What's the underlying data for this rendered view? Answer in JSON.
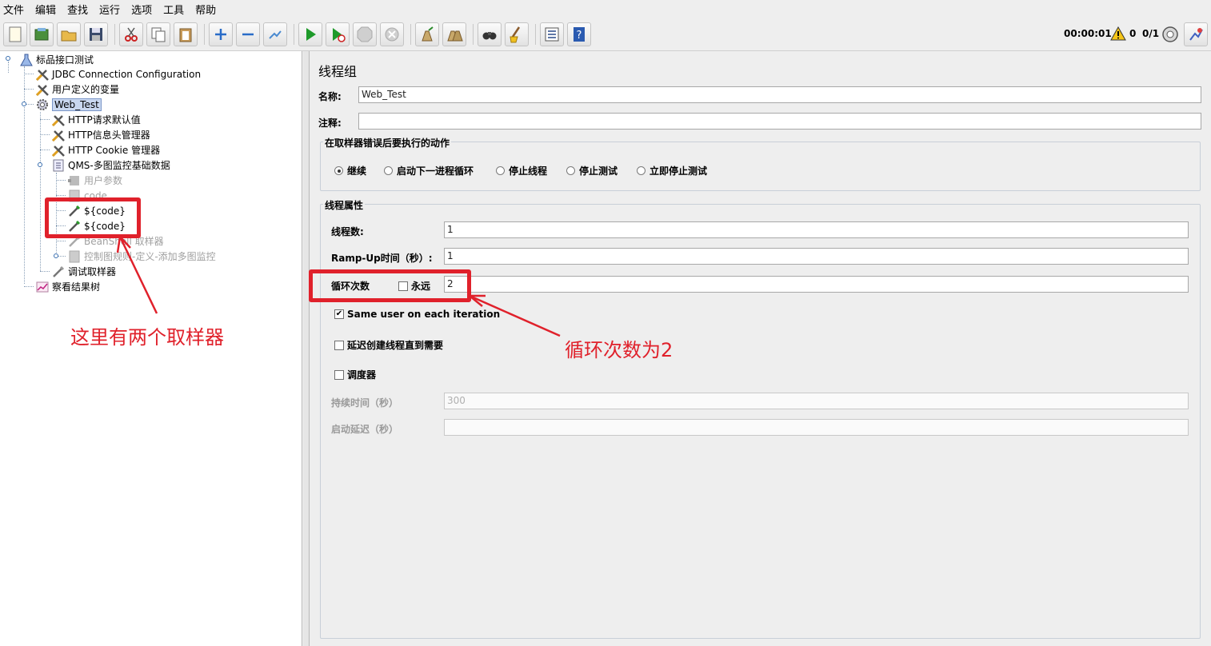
{
  "menu": [
    "文件",
    "编辑",
    "查找",
    "运行",
    "选项",
    "工具",
    "帮助"
  ],
  "toolbar": {
    "buttons": [
      "new-icon",
      "templates-icon",
      "open-icon",
      "save-icon",
      "cut-icon",
      "copy-icon",
      "paste-icon",
      "expand-icon",
      "collapse-icon",
      "toggle-icon",
      "start-icon",
      "start-no-pause-icon",
      "stop-icon",
      "shutdown-icon",
      "clear-icon",
      "clear-all-icon",
      "search-icon",
      "reset-search-icon",
      "function-helper-icon",
      "help-icon"
    ],
    "timer": "00:00:01",
    "warning_count": "0",
    "thread_ratio": "0/1"
  },
  "tree": {
    "items": [
      {
        "label": "标品接口测试",
        "icon": "test-plan-icon",
        "disabled": false
      },
      {
        "label": "JDBC Connection Configuration",
        "icon": "config-wrench-icon",
        "disabled": false
      },
      {
        "label": "用户定义的变量",
        "icon": "config-wrench-icon",
        "disabled": false
      },
      {
        "label": "Web_Test",
        "icon": "thread-group-gear-icon",
        "disabled": false,
        "selected": true
      },
      {
        "label": "HTTP请求默认值",
        "icon": "config-wrench-icon",
        "disabled": false
      },
      {
        "label": "HTTP信息头管理器",
        "icon": "config-wrench-icon",
        "disabled": false
      },
      {
        "label": "HTTP Cookie 管理器",
        "icon": "config-wrench-icon",
        "disabled": false
      },
      {
        "label": "QMS-多图监控基础数据",
        "icon": "controller-icon",
        "disabled": false
      },
      {
        "label": "用户参数",
        "icon": "preprocessor-icon",
        "disabled": true
      },
      {
        "label": "code",
        "icon": "controller-icon",
        "disabled": true
      },
      {
        "label": "${code}",
        "icon": "sampler-pen-icon",
        "disabled": false
      },
      {
        "label": "${code}",
        "icon": "sampler-pen-icon",
        "disabled": false
      },
      {
        "label": "BeanShell 取样器",
        "icon": "sampler-pen-icon",
        "disabled": true
      },
      {
        "label": "控制图规则-定义-添加多图监控",
        "icon": "controller-icon",
        "disabled": true
      },
      {
        "label": "调试取样器",
        "icon": "sampler-pen-icon",
        "disabled": false
      },
      {
        "label": "察看结果树",
        "icon": "listener-graph-icon",
        "disabled": false
      }
    ]
  },
  "panel": {
    "title": "线程组",
    "name_label": "名称:",
    "name_value": "Web_Test",
    "comment_label": "注释:",
    "comment_value": "",
    "error_group_title": "在取样器错误后要执行的动作",
    "error_options": [
      "继续",
      "启动下一进程循环",
      "停止线程",
      "停止测试",
      "立即停止测试"
    ],
    "error_selected": "继续",
    "thread_props_title": "线程属性",
    "threads_label": "线程数:",
    "threads_value": "1",
    "rampup_label": "Ramp-Up时间（秒）:",
    "rampup_value": "1",
    "loop_label": "循环次数",
    "forever_label": "永远",
    "loop_value": "2",
    "same_user_label": "Same user on each iteration",
    "same_user_checked": true,
    "delay_label": "延迟创建线程直到需要",
    "scheduler_label": "调度器",
    "duration_label": "持续时间（秒）",
    "duration_value": "300",
    "startup_delay_label": "启动延迟（秒）",
    "startup_delay_value": ""
  },
  "annotations": {
    "left_note": "这里有两个取样器",
    "right_note": "循环次数为2",
    "color": "#e0212b"
  }
}
